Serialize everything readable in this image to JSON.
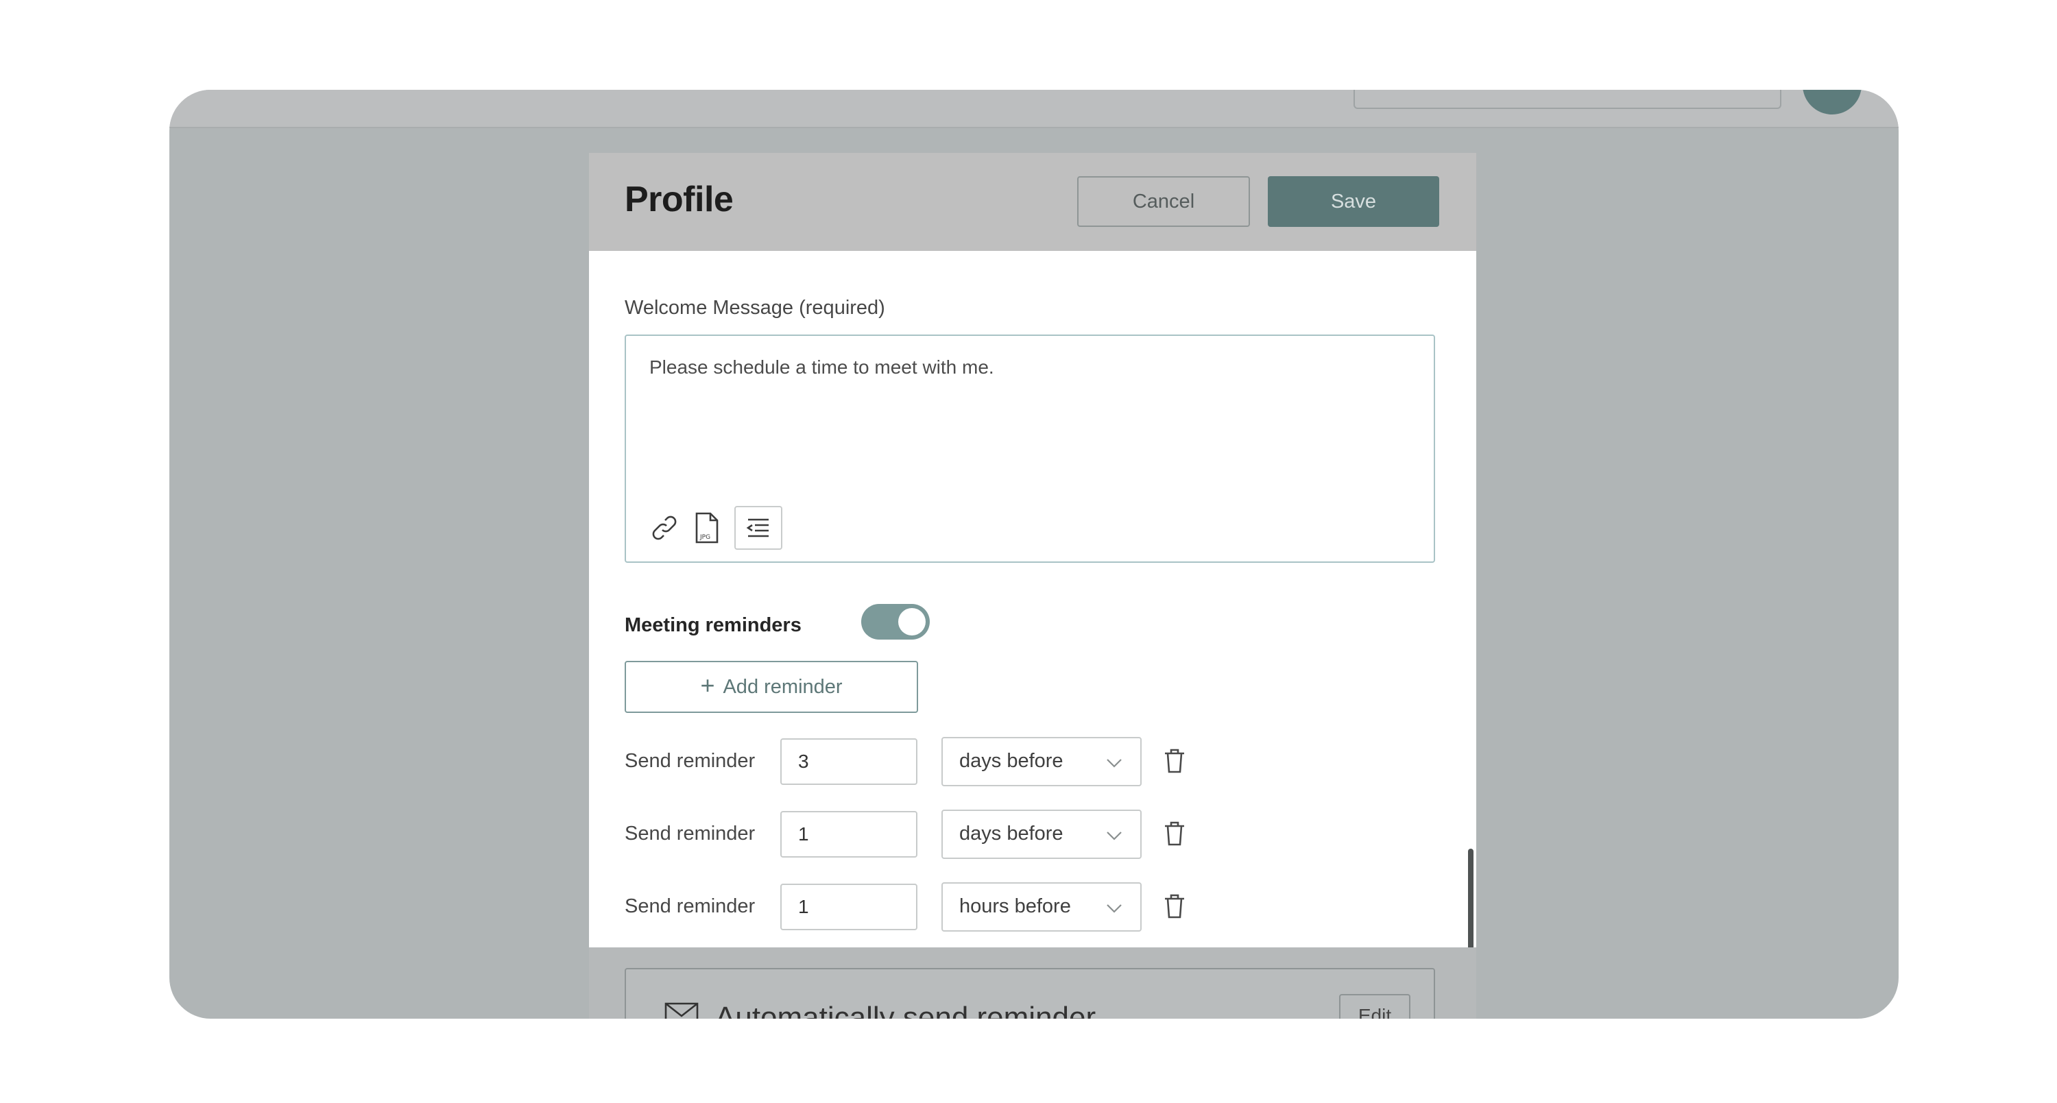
{
  "modal": {
    "title": "Profile",
    "cancel_label": "Cancel",
    "save_label": "Save"
  },
  "welcome": {
    "label": "Welcome Message (required)",
    "value": "Please schedule a time to meet with me.",
    "toolbar_icons": [
      "link-icon",
      "jpg-file-icon",
      "outdent-icon"
    ]
  },
  "reminders": {
    "label": "Meeting reminders",
    "enabled": true,
    "add_label": "Add reminder",
    "rows": [
      {
        "label": "Send reminder",
        "value": "3",
        "unit": "days before"
      },
      {
        "label": "Send reminder",
        "value": "1",
        "unit": "days before"
      },
      {
        "label": "Send reminder",
        "value": "1",
        "unit": "hours before"
      }
    ]
  },
  "auto_send": {
    "label": "Automatically send reminder",
    "edit_label": "Edit"
  },
  "colors": {
    "accent": "#5b7878",
    "toggle_on": "#7c9a9a",
    "overlay": "#b0b5b6"
  }
}
